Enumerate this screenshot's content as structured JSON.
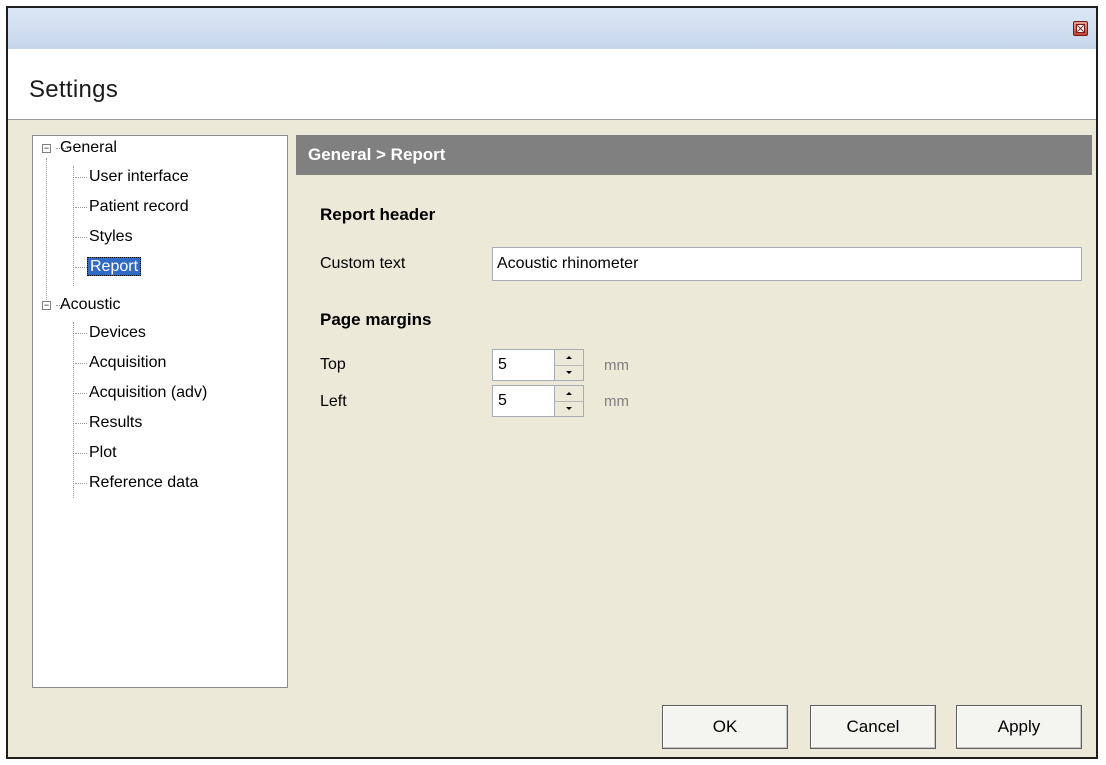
{
  "window": {
    "title": "Settings"
  },
  "tree": {
    "general": {
      "label": "General",
      "children": [
        "User interface",
        "Patient record",
        "Styles",
        "Report"
      ]
    },
    "acoustic": {
      "label": "Acoustic",
      "children": [
        "Devices",
        "Acquisition",
        "Acquisition (adv)",
        "Results",
        "Plot",
        "Reference data"
      ]
    },
    "selected": "Report"
  },
  "panel": {
    "breadcrumb": "General > Report",
    "report_header": {
      "title": "Report header",
      "custom_text_label": "Custom text",
      "custom_text_value": "Acoustic rhinometer"
    },
    "page_margins": {
      "title": "Page margins",
      "top_label": "Top",
      "top_value": "5",
      "left_label": "Left",
      "left_value": "5",
      "unit": "mm"
    }
  },
  "buttons": {
    "ok": "OK",
    "cancel": "Cancel",
    "apply": "Apply"
  },
  "colors": {
    "selection": "#316ac5",
    "panel_header": "#808080",
    "dialog_bg": "#ece9d8"
  }
}
